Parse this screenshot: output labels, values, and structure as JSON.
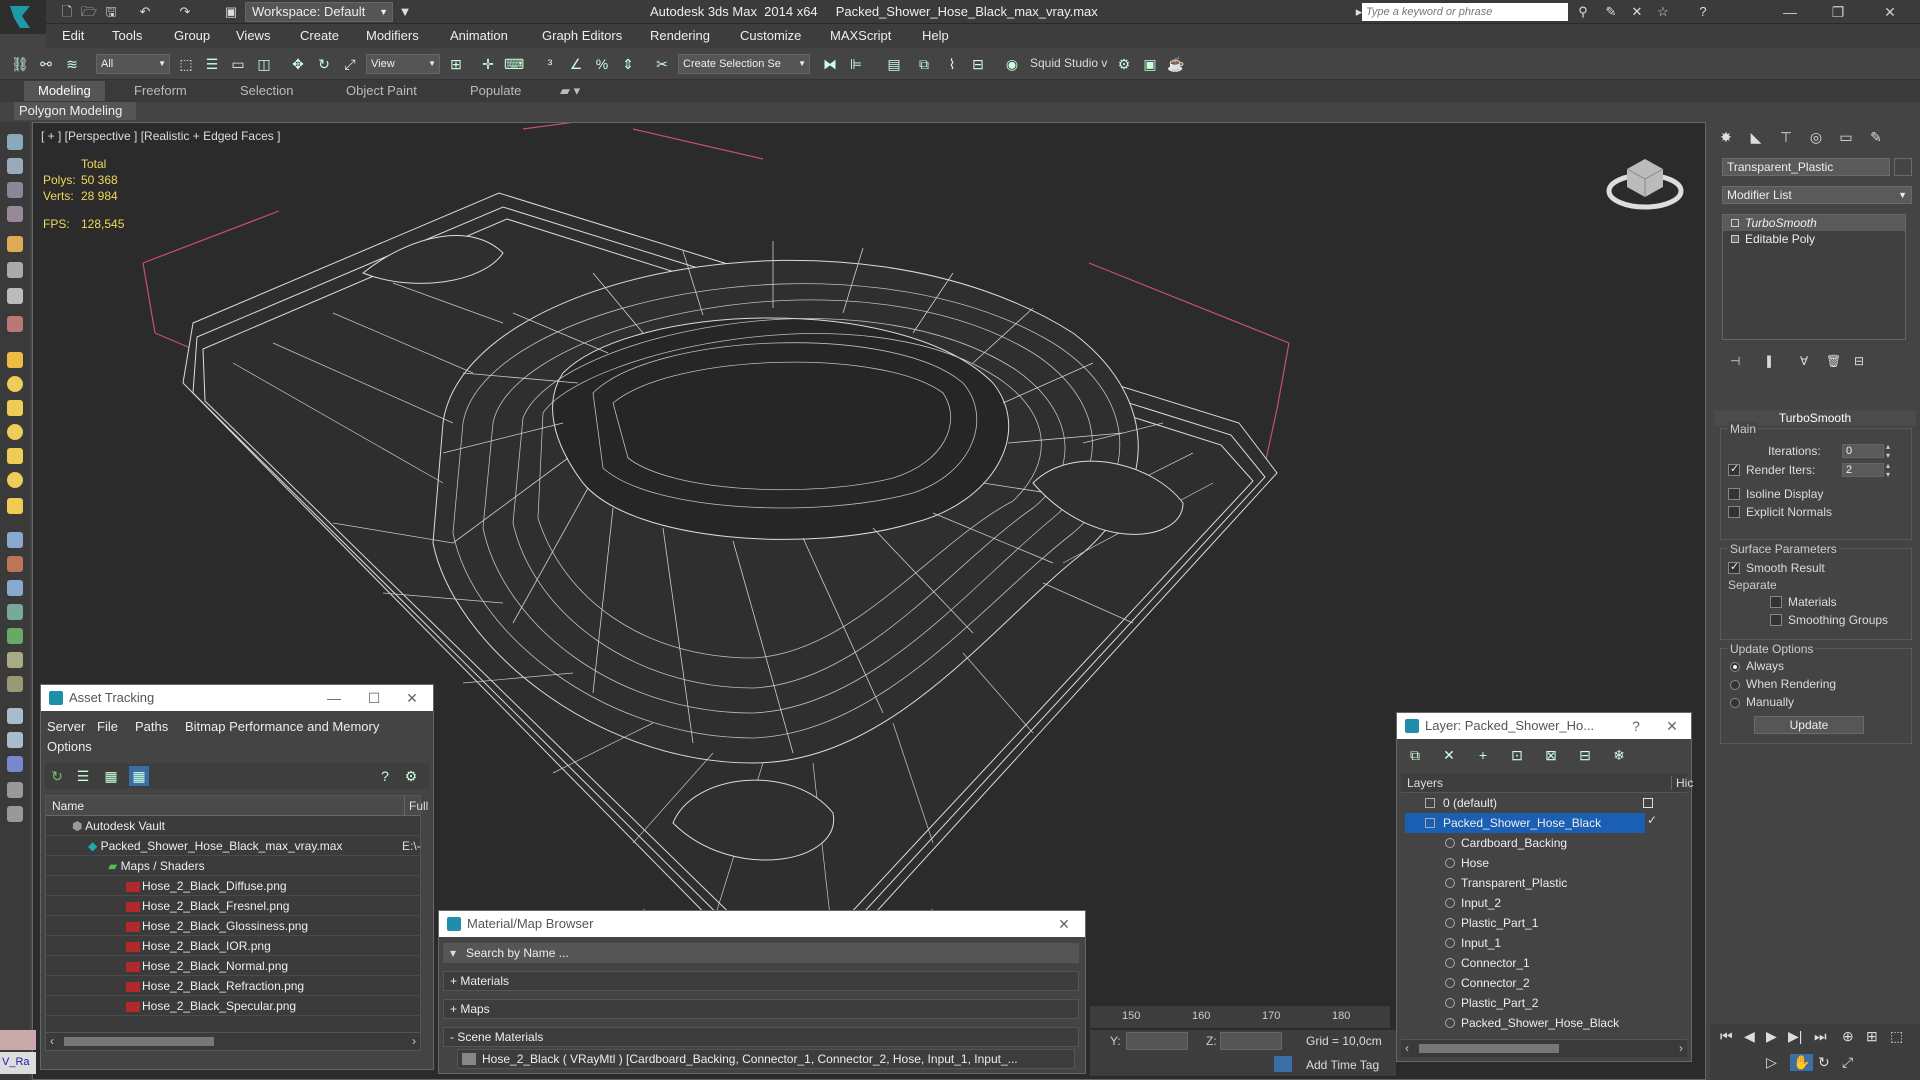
{
  "titlebar": {
    "workspace": "Workspace: Default",
    "title": "Autodesk 3ds Max  2014 x64     Packed_Shower_Hose_Black_max_vray.max",
    "search_placeholder": "Type a keyword or phrase"
  },
  "menu": [
    "Edit",
    "Tools",
    "Group",
    "Views",
    "Create",
    "Modifiers",
    "Animation",
    "Graph Editors",
    "Rendering",
    "Customize",
    "MAXScript",
    "Help"
  ],
  "toolbar": {
    "filter": "All",
    "ref_coord": "View",
    "selection_set": "Create Selection Se",
    "plugin": "Squid Studio v"
  },
  "ribbon": {
    "tabs": [
      "Modeling",
      "Freeform",
      "Selection",
      "Object Paint",
      "Populate"
    ],
    "sub": "Polygon Modeling"
  },
  "viewport": {
    "label": "[ + ] [Perspective ] [Realistic + Edged Faces ]",
    "stats_header": "Total",
    "polys_label": "Polys:",
    "polys": "50 368",
    "verts_label": "Verts:",
    "verts": "28 984",
    "fps_label": "FPS:",
    "fps": "128,545"
  },
  "command_panel": {
    "object_name": "Transparent_Plastic",
    "modifier_list": "Modifier List",
    "stack": [
      "TurboSmooth",
      "Editable Poly"
    ],
    "rollout": "TurboSmooth",
    "main_group": "Main",
    "iterations_label": "Iterations:",
    "iterations": "0",
    "render_iters_label": "Render Iters:",
    "render_iters": "2",
    "isoline": "Isoline Display",
    "explicit_normals": "Explicit Normals",
    "surface_params": "Surface Parameters",
    "smooth_result": "Smooth Result",
    "separate": "Separate",
    "materials": "Materials",
    "smoothing_groups": "Smoothing Groups",
    "update_options": "Update Options",
    "always": "Always",
    "when_rendering": "When Rendering",
    "manually": "Manually",
    "update": "Update"
  },
  "asset_tracking": {
    "title": "Asset Tracking",
    "menu": [
      "Server",
      "File",
      "Paths",
      "Bitmap Performance and Memory",
      "Options"
    ],
    "col_name": "Name",
    "col_full": "Full",
    "rows": [
      {
        "name": "Autodesk Vault",
        "full": ""
      },
      {
        "name": "Packed_Shower_Hose_Black_max_vray.max",
        "full": "E:\\-"
      },
      {
        "name": "Maps / Shaders",
        "full": ""
      },
      {
        "name": "Hose_2_Black_Diffuse.png",
        "full": ""
      },
      {
        "name": "Hose_2_Black_Fresnel.png",
        "full": ""
      },
      {
        "name": "Hose_2_Black_Glossiness.png",
        "full": ""
      },
      {
        "name": "Hose_2_Black_IOR.png",
        "full": ""
      },
      {
        "name": "Hose_2_Black_Normal.png",
        "full": ""
      },
      {
        "name": "Hose_2_Black_Refraction.png",
        "full": ""
      },
      {
        "name": "Hose_2_Black_Specular.png",
        "full": ""
      }
    ]
  },
  "material_browser": {
    "title": "Material/Map Browser",
    "search": "Search by Name ...",
    "sections": [
      "+ Materials",
      "+ Maps",
      "- Scene Materials"
    ],
    "entry": "Hose_2_Black ( VRayMtl ) [Cardboard_Backing, Connector_1, Connector_2, Hose, Input_1, Input_..."
  },
  "layers": {
    "title": "Layer: Packed_Shower_Ho...",
    "col_layers": "Layers",
    "col_hide": "Hic",
    "rows": [
      "0 (default)",
      "Packed_Shower_Hose_Black",
      "Cardboard_Backing",
      "Hose",
      "Transparent_Plastic",
      "Input_2",
      "Plastic_Part_1",
      "Input_1",
      "Connector_1",
      "Connector_2",
      "Plastic_Part_2",
      "Packed_Shower_Hose_Black"
    ]
  },
  "bottom": {
    "ruler": [
      "150",
      "160",
      "170",
      "180"
    ],
    "y_label": "Y:",
    "z_label": "Z:",
    "grid": "Grid = 10,0cm",
    "add_time_tag": "Add Time Tag",
    "script_label": "V_Ra"
  }
}
